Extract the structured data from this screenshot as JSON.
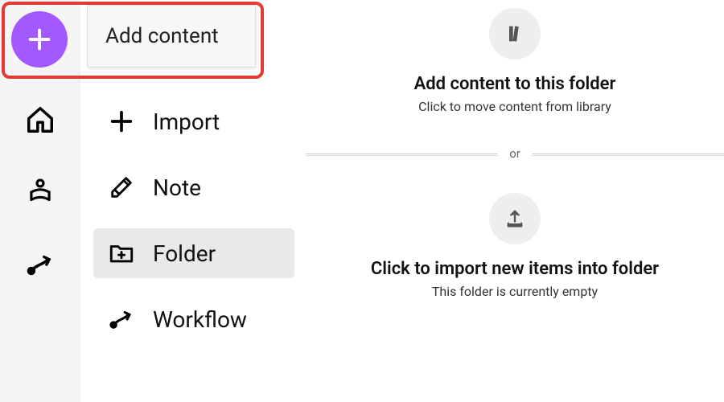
{
  "fab": {
    "label": "Add"
  },
  "popover": {
    "title": "Add content"
  },
  "rail": {
    "home": "Home",
    "library": "Library",
    "workflow": "Workflows"
  },
  "menu": {
    "import": "Import",
    "note": "Note",
    "folder": "Folder",
    "workflow": "Workflow"
  },
  "main": {
    "add": {
      "title": "Add content to this folder",
      "subtitle": "Click to move content from library"
    },
    "or": "or",
    "import": {
      "title": "Click to import new items into folder",
      "subtitle": "This folder is currently empty"
    }
  }
}
